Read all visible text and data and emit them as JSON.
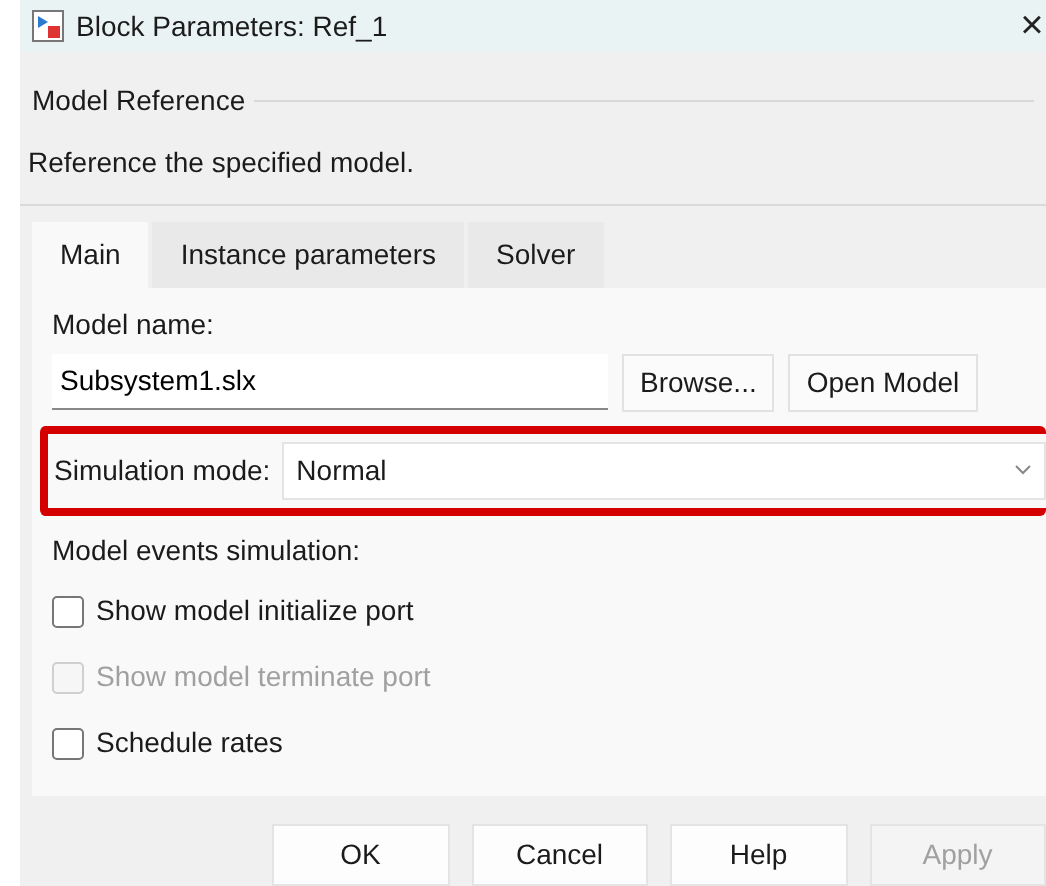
{
  "window": {
    "title": "Block Parameters: Ref_1",
    "close": "×"
  },
  "header": {
    "title": "Model Reference",
    "description": "Reference the specified model."
  },
  "tabs": [
    {
      "label": "Main",
      "selected": true
    },
    {
      "label": "Instance parameters",
      "selected": false
    },
    {
      "label": "Solver",
      "selected": false
    }
  ],
  "model_name": {
    "label": "Model name:",
    "value": "Subsystem1.slx",
    "buttons": [
      {
        "label": "Browse..."
      },
      {
        "label": "Open Model"
      }
    ]
  },
  "simulation_mode": {
    "label": "Simulation mode:",
    "value": "Normal",
    "highlighted": true
  },
  "events": {
    "label": "Model events simulation:",
    "options": [
      {
        "label": "Show model initialize port",
        "checked": false,
        "disabled": false
      },
      {
        "label": "Show model terminate port",
        "checked": false,
        "disabled": true
      },
      {
        "label": "Schedule rates",
        "checked": false,
        "disabled": false
      }
    ]
  },
  "buttons": [
    {
      "label": "OK",
      "disabled": false
    },
    {
      "label": "Cancel",
      "disabled": false
    },
    {
      "label": "Help",
      "disabled": false
    },
    {
      "label": "Apply",
      "disabled": true
    }
  ]
}
